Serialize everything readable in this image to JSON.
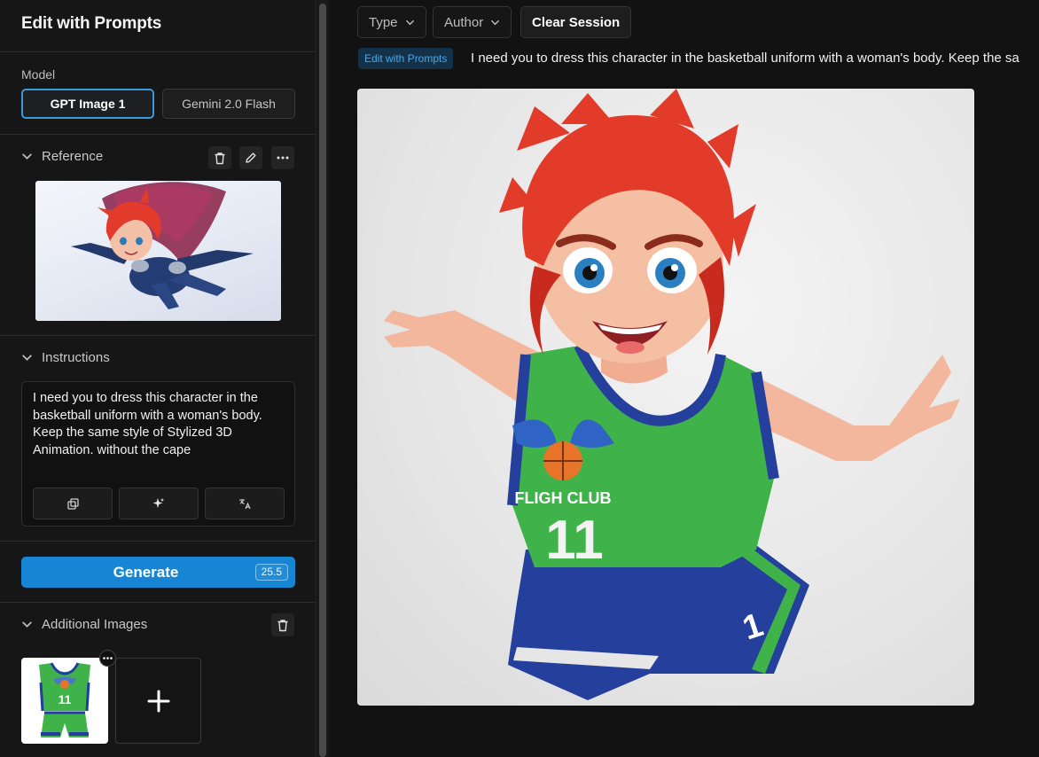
{
  "sidebar": {
    "title": "Edit with Prompts",
    "model": {
      "label": "Model",
      "options": [
        "GPT Image 1",
        "Gemini 2.0 Flash"
      ],
      "selected": "GPT Image 1"
    },
    "reference": {
      "label": "Reference"
    },
    "instructions": {
      "label": "Instructions",
      "text": "I need you to dress this character in the basketball uniform with a woman's body. Keep the same style of Stylized 3D Animation. without the cape"
    },
    "generate": {
      "label": "Generate",
      "cost": "25.5"
    },
    "additional_images": {
      "label": "Additional Images",
      "add_symbol": "+"
    }
  },
  "main": {
    "filters": {
      "type": "Type",
      "author": "Author",
      "clear": "Clear Session"
    },
    "entry": {
      "tag": "Edit with Prompts",
      "prompt": "I need you to dress this character in the basketball uniform with a woman's body. Keep the sa"
    },
    "jersey_text": {
      "team": "FLIGH CLUB",
      "number": "11",
      "shorts_number": "1"
    }
  },
  "colors": {
    "accent": "#1685d4",
    "selected_border": "#3a9ad9",
    "jersey_green": "#3fb34a",
    "jersey_blue": "#1f3e9e",
    "hair_red": "#e43b2a"
  }
}
